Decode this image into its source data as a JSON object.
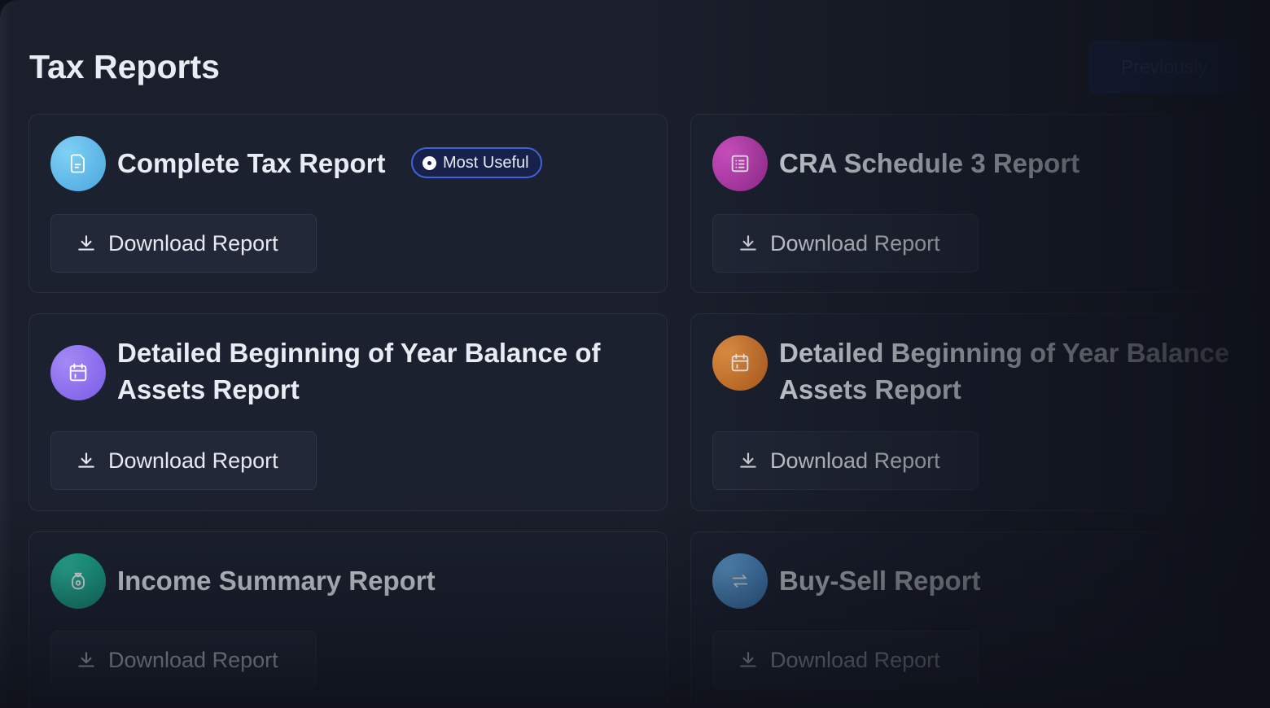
{
  "header": {
    "title": "Tax Reports",
    "previously_label": "Previously"
  },
  "download_label": "Download Report",
  "badge_label": "Most Useful",
  "reports": [
    {
      "title": "Complete Tax Report",
      "icon": "document-icon",
      "color": "#5ab8e8"
    },
    {
      "title": "CRA Schedule 3 Report",
      "icon": "list-icon",
      "color": "#c13bb7"
    },
    {
      "title_line1": "Detailed Beginning of Year Balance of",
      "title_line2": "Assets Report",
      "icon": "calendar-icon",
      "color": "#8a6ef0"
    },
    {
      "title_line1": "Detailed Beginning of Year Balance",
      "title_line2": "Assets Report",
      "icon": "calendar-icon",
      "color": "#d97a2a"
    },
    {
      "title": "Income Summary Report",
      "icon": "money-bag-icon",
      "color": "#14a58c"
    },
    {
      "title": "Buy-Sell Report",
      "icon": "swap-icon",
      "color": "#4a93d6"
    }
  ]
}
